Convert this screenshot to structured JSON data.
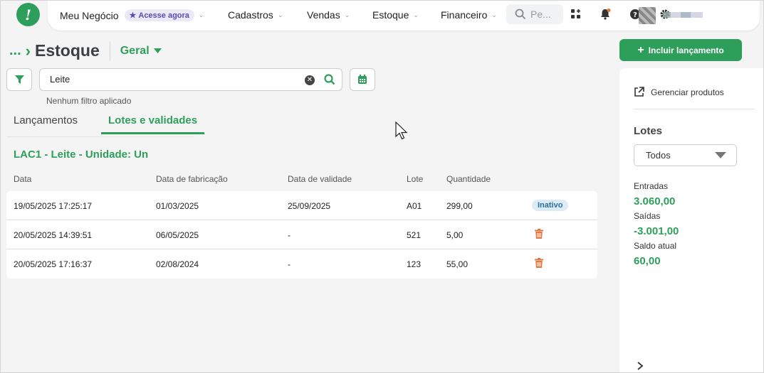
{
  "nav": {
    "business": "Meu Negócio",
    "acesse": "Acesse agora",
    "cadastros": "Cadastros",
    "vendas": "Vendas",
    "estoque": "Estoque",
    "financeiro": "Financeiro",
    "search_placeholder": "Pe..."
  },
  "page": {
    "breadcrumb_dots": "...",
    "title": "Estoque",
    "view": "Geral"
  },
  "filter": {
    "search_value": "Leite",
    "note": "Nenhum filtro aplicado"
  },
  "tabs": [
    {
      "label": "Lançamentos",
      "active": false
    },
    {
      "label": "Lotes e validades",
      "active": true
    }
  ],
  "product_heading": "LAC1 - Leite - Unidade: Un",
  "table": {
    "headers": [
      "Data",
      "Data de fabricação",
      "Data de validade",
      "Lote",
      "Quantidade"
    ],
    "rows": [
      {
        "data": "19/05/2025 17:25:17",
        "fabricacao": "01/03/2025",
        "validade": "25/09/2025",
        "lote": "A01",
        "quantidade": "299,00",
        "status": "Inativo"
      },
      {
        "data": "20/05/2025 14:39:51",
        "fabricacao": "06/05/2025",
        "validade": "-",
        "lote": "521",
        "quantidade": "5,00"
      },
      {
        "data": "20/05/2025 17:16:37",
        "fabricacao": "02/08/2024",
        "validade": "-",
        "lote": "123",
        "quantidade": "55,00"
      }
    ]
  },
  "side": {
    "primary_button": "Incluir lançamento",
    "manage_products": "Gerenciar produtos",
    "lotes_title": "Lotes",
    "lote_select": "Todos",
    "entradas_label": "Entradas",
    "entradas_value": "3.060,00",
    "saidas_label": "Saídas",
    "saidas_value": "-3.001,00",
    "saldo_label": "Saldo atual",
    "saldo_value": "60,00"
  },
  "colors": {
    "brand": "#2e9f5b",
    "badge_bg": "#dcecf7",
    "trash": "#e07a3f"
  },
  "icons": [
    "logo-icon",
    "star-icon",
    "search-icon",
    "apps-icon",
    "bell-icon",
    "help-icon",
    "gear-icon",
    "filter-icon",
    "clear-icon",
    "calendar-icon",
    "trash-icon",
    "external-link-icon",
    "chevron-right-icon",
    "plus-icon"
  ]
}
